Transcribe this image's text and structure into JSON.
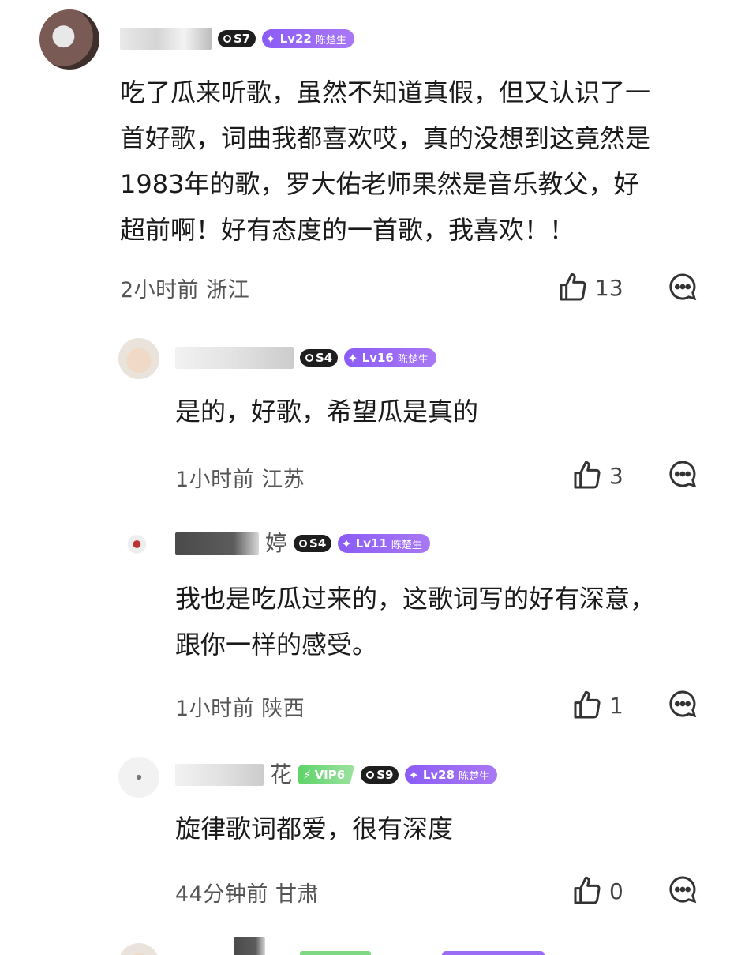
{
  "comments": [
    {
      "name_tail": "",
      "s_badge": "S7",
      "lv_badge": "Lv22",
      "lv_name": "陈楚生",
      "text": "吃了瓜来听歌，虽然不知道真假，但又认识了一\n首好歌，词曲我都喜欢哎，真的没想到这竟然是\n1983年的歌，罗大佑老师果然是音乐教父，好\n超前啊！好有态度的一首歌，我喜欢！！",
      "time": "2小时前",
      "region": "浙江",
      "likes": "13"
    },
    {
      "name_tail": "",
      "s_badge": "S4",
      "lv_badge": "Lv16",
      "lv_name": "陈楚生",
      "text": "是的，好歌，希望瓜是真的",
      "time": "1小时前",
      "region": "江苏",
      "likes": "3"
    },
    {
      "name_tail": "婷",
      "s_badge": "S4",
      "lv_badge": "Lv11",
      "lv_name": "陈楚生",
      "text": "我也是吃瓜过来的，这歌词写的好有深意，\n跟你一样的感受。",
      "time": "1小时前",
      "region": "陕西",
      "likes": "1"
    },
    {
      "name_tail": "花",
      "vip_badge": "VIP6",
      "s_badge": "S9",
      "lv_badge": "Lv28",
      "lv_name": "陈楚生",
      "text": "旋律歌词都爱，很有深度",
      "time": "44分钟前",
      "region": "甘肃",
      "likes": "0"
    }
  ],
  "icons": {
    "like": "thumbs-up-icon",
    "reply": "comment-bubble-icon",
    "lv_star": "sparkle-icon",
    "vip": "lightning-icon"
  },
  "colors": {
    "lv_badge": "#8b5cf6",
    "vip_badge": "#5fd36a",
    "s_badge": "#1e1e1e"
  }
}
